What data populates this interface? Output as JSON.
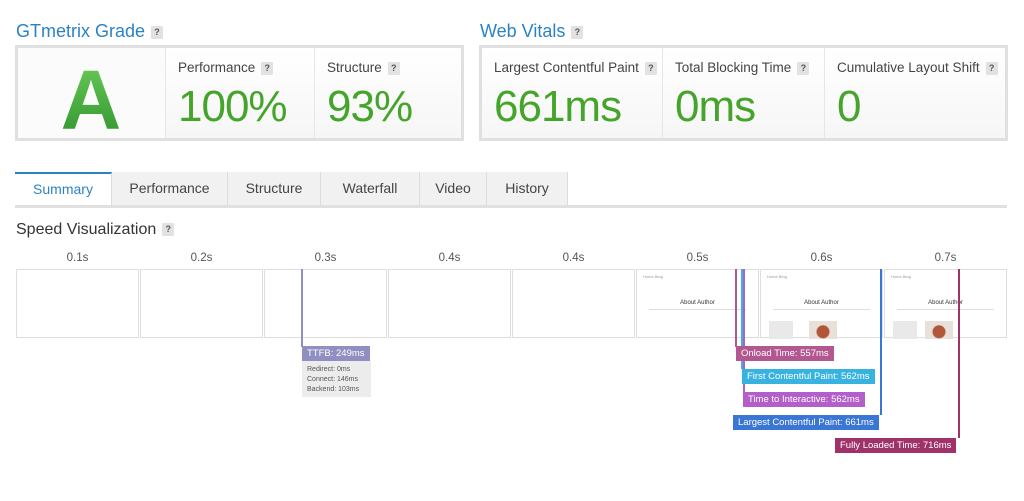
{
  "grade": {
    "title": "GTmetrix Grade",
    "help": "?",
    "letter": "A",
    "performance_label": "Performance",
    "performance_value": "100%",
    "structure_label": "Structure",
    "structure_value": "93%"
  },
  "vitals": {
    "title": "Web Vitals",
    "help": "?",
    "lcp_label": "Largest Contentful Paint",
    "lcp_value": "661ms",
    "tbt_label": "Total Blocking Time",
    "tbt_value": "0ms",
    "cls_label": "Cumulative Layout Shift",
    "cls_value": "0"
  },
  "tabs": [
    "Summary",
    "Performance",
    "Structure",
    "Waterfall",
    "Video",
    "History"
  ],
  "active_tab": "Summary",
  "speed": {
    "title": "Speed Visualization",
    "help": "?",
    "times": [
      "0.1s",
      "0.2s",
      "0.3s",
      "0.4s",
      "0.4s",
      "0.5s",
      "0.6s",
      "0.7s"
    ],
    "frame_page_title": "About Author",
    "frame_header_text": "Home Blog",
    "ttfb": {
      "label": "TTFB: 249ms",
      "redirect": "Redirect: 0ms",
      "connect": "Connect: 146ms",
      "backend": "Backend: 103ms",
      "color": "#8f8fc2"
    },
    "markers": {
      "onload": {
        "label": "Onload Time: 557ms",
        "color": "#b2578f"
      },
      "fcp": {
        "label": "First Contentful Paint: 562ms",
        "color": "#38b3e0"
      },
      "tti": {
        "label": "Time to Interactive: 562ms",
        "color": "#b25fc9"
      },
      "lcp": {
        "label": "Largest Contentful Paint: 661ms",
        "color": "#3a76d6"
      },
      "fully_loaded": {
        "label": "Fully Loaded Time: 716ms",
        "color": "#a0326a"
      }
    }
  },
  "colors": {
    "accent": "#2a83c6",
    "good": "#45a52a"
  }
}
